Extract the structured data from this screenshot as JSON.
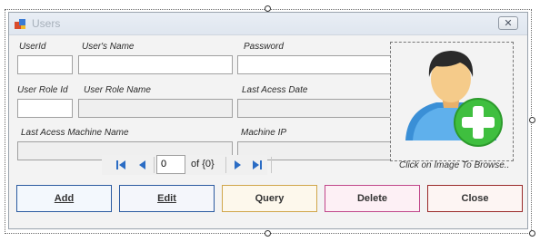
{
  "window": {
    "title": "Users",
    "close_symbol": "✕"
  },
  "labels": {
    "userid": "UserId",
    "user_name": "User's Name",
    "password": "Password",
    "role_id": "User Role Id",
    "role_name": "User Role Name",
    "last_access_date": "Last Acess Date",
    "last_access_machine": "Last Acess Machine Name",
    "machine_ip": "Machine IP"
  },
  "fields": {
    "userid": "",
    "user_name": "",
    "password": "",
    "role_id": "",
    "role_name": "",
    "last_access_date": "",
    "last_access_machine": "",
    "machine_ip": ""
  },
  "picture": {
    "hint": "Click on Image To Browse..",
    "icon": "add-user-icon"
  },
  "navigator": {
    "position": "0",
    "count_text": "of {0}"
  },
  "buttons": {
    "add": {
      "label": "Add",
      "color": "#2b5aa0",
      "bg": "#f3f8fd"
    },
    "edit": {
      "label": "Edit",
      "color": "#2b5aa0",
      "bg": "#f4f6fb"
    },
    "query": {
      "label": "Query",
      "color": "#d0a64a",
      "bg": "#fdf8ec"
    },
    "delete": {
      "label": "Delete",
      "color": "#c0468a",
      "bg": "#fdf0f5"
    },
    "close": {
      "label": "Close",
      "color": "#9a2a2a",
      "bg": "#fdf5f3"
    }
  }
}
